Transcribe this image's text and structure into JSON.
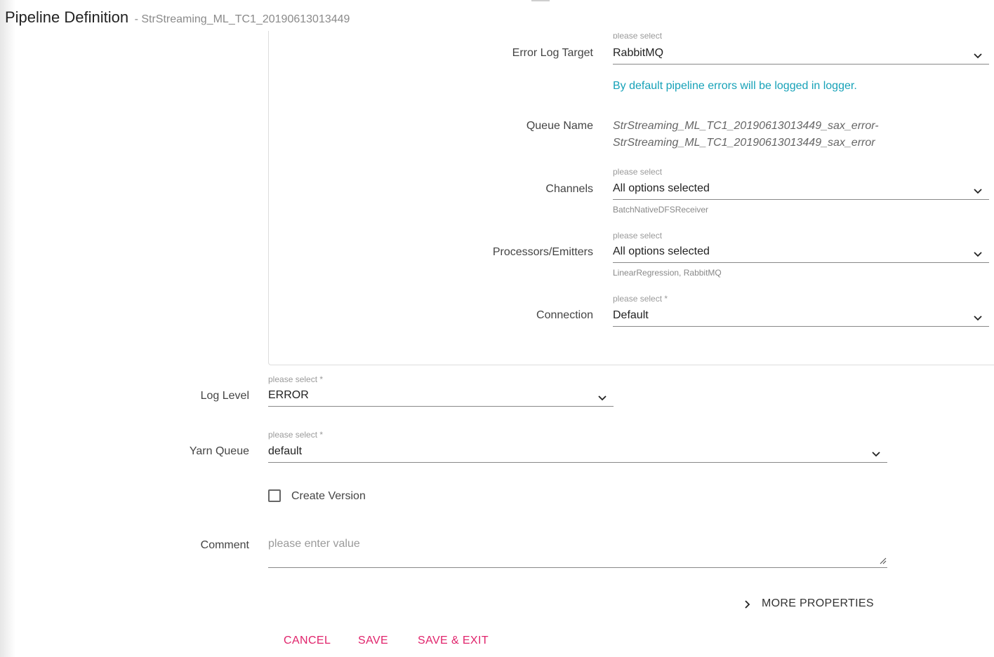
{
  "header": {
    "title": "Pipeline Definition",
    "subtitle": "- StrStreaming_ML_TC1_20190613013449"
  },
  "error_log_target": {
    "hint": "please select",
    "label": "Error Log Target",
    "value": "RabbitMQ",
    "info": "By default pipeline errors will be logged in logger."
  },
  "queue_name": {
    "label": "Queue Name",
    "line1": "StrStreaming_ML_TC1_20190613013449_sax_error-",
    "line2": "StrStreaming_ML_TC1_20190613013449_sax_error"
  },
  "channels": {
    "hint": "please select",
    "label": "Channels",
    "value": "All options selected",
    "selected": "BatchNativeDFSReceiver"
  },
  "processors": {
    "hint": "please select",
    "label": "Processors/Emitters",
    "value": "All options selected",
    "selected": "LinearRegression, RabbitMQ"
  },
  "connection": {
    "hint": "please select *",
    "label": "Connection",
    "value": "Default"
  },
  "log_level": {
    "hint": "please select *",
    "label": "Log Level",
    "value": "ERROR"
  },
  "yarn_queue": {
    "hint": "please select *",
    "label": "Yarn Queue",
    "value": "default"
  },
  "create_version": {
    "label": "Create Version",
    "checked": false
  },
  "comment": {
    "label": "Comment",
    "placeholder": "please enter value"
  },
  "more_properties": "MORE PROPERTIES",
  "buttons": {
    "cancel": "CANCEL",
    "save": "SAVE",
    "save_exit": "SAVE & EXIT"
  },
  "colors": {
    "accent": "#e0236b",
    "info": "#17a2b8"
  }
}
